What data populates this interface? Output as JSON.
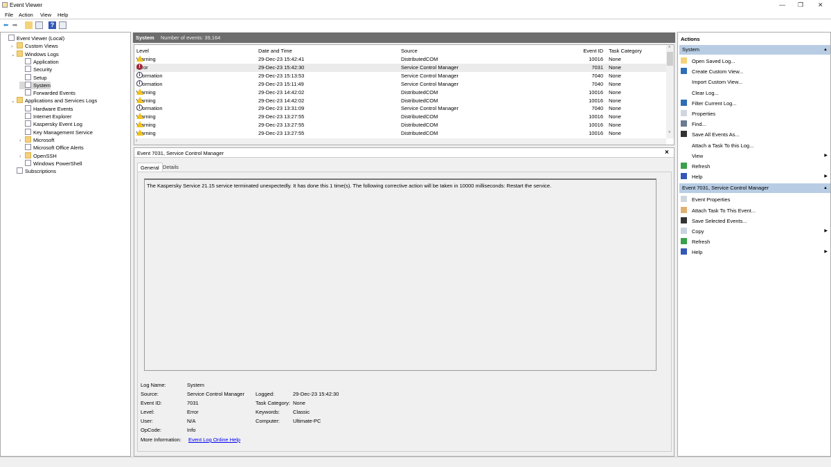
{
  "window": {
    "title": "Event Viewer",
    "minimize": "—",
    "restore": "❐",
    "close": "✕"
  },
  "menu": [
    "File",
    "Action",
    "View",
    "Help"
  ],
  "tree": [
    {
      "label": "Event Viewer (Local)",
      "level": 0,
      "exp": ""
    },
    {
      "label": "Custom Views",
      "level": 1,
      "exp": "›"
    },
    {
      "label": "Windows Logs",
      "level": 1,
      "exp": "⌄"
    },
    {
      "label": "Application",
      "level": 2,
      "exp": ""
    },
    {
      "label": "Security",
      "level": 2,
      "exp": ""
    },
    {
      "label": "Setup",
      "level": 2,
      "exp": ""
    },
    {
      "label": "System",
      "level": 2,
      "exp": "",
      "selected": true
    },
    {
      "label": "Forwarded Events",
      "level": 2,
      "exp": ""
    },
    {
      "label": "Applications and Services Logs",
      "level": 1,
      "exp": "⌄"
    },
    {
      "label": "Hardware Events",
      "level": 2,
      "exp": ""
    },
    {
      "label": "Internet Explorer",
      "level": 2,
      "exp": ""
    },
    {
      "label": "Kaspersky Event Log",
      "level": 2,
      "exp": ""
    },
    {
      "label": "Key Management Service",
      "level": 2,
      "exp": ""
    },
    {
      "label": "Microsoft",
      "level": 2,
      "exp": "›",
      "folder": true
    },
    {
      "label": "Microsoft Office Alerts",
      "level": 2,
      "exp": ""
    },
    {
      "label": "OpenSSH",
      "level": 2,
      "exp": "›",
      "folder": true
    },
    {
      "label": "Windows PowerShell",
      "level": 2,
      "exp": ""
    },
    {
      "label": "Subscriptions",
      "level": 1,
      "exp": ""
    }
  ],
  "log": {
    "name": "System",
    "count_label": "Number of events: 39,164",
    "columns": [
      "Level",
      "Date and Time",
      "Source",
      "Event ID",
      "Task Category"
    ],
    "rows": [
      [
        "Warning",
        "29-Dec-23 15:42:41",
        "DistributedCOM",
        "10016",
        "None"
      ],
      [
        "Error",
        "29-Dec-23 15:42:30",
        "Service Control Manager",
        "7031",
        "None"
      ],
      [
        "Information",
        "29-Dec-23 15:13:53",
        "Service Control Manager",
        "7040",
        "None"
      ],
      [
        "Information",
        "29-Dec-23 15:11:49",
        "Service Control Manager",
        "7040",
        "None"
      ],
      [
        "Warning",
        "29-Dec-23 14:42:02",
        "DistributedCOM",
        "10016",
        "None"
      ],
      [
        "Warning",
        "29-Dec-23 14:42:02",
        "DistributedCOM",
        "10016",
        "None"
      ],
      [
        "Information",
        "29-Dec-23 13:31:09",
        "Service Control Manager",
        "7040",
        "None"
      ],
      [
        "Warning",
        "29-Dec-23 13:27:55",
        "DistributedCOM",
        "10016",
        "None"
      ],
      [
        "Warning",
        "29-Dec-23 13:27:55",
        "DistributedCOM",
        "10016",
        "None"
      ],
      [
        "Warning",
        "29-Dec-23 13:27:55",
        "DistributedCOM",
        "10016",
        "None"
      ]
    ],
    "selected_row": 1
  },
  "detail": {
    "title": "Event 7031, Service Control Manager",
    "close": "×",
    "tabs": [
      "General",
      "Details"
    ],
    "message": "The Kaspersky Service 21.15 service terminated unexpectedly.  It has done this 1 time(s).  The following corrective action will be taken in 10000 milliseconds: Restart the service.",
    "left_fields": [
      [
        "Log Name:",
        "System"
      ],
      [
        "Source:",
        "Service Control Manager"
      ],
      [
        "Event ID:",
        "7031"
      ],
      [
        "Level:",
        "Error"
      ],
      [
        "User:",
        "N/A"
      ],
      [
        "OpCode:",
        "Info"
      ]
    ],
    "right_fields": [
      [
        "Logged:",
        "29-Dec-23 15:42:30"
      ],
      [
        "Task Category:",
        "None"
      ],
      [
        "Keywords:",
        "Classic"
      ],
      [
        "Computer:",
        "Ultimate-PC"
      ]
    ],
    "more_info_label": "More Information:",
    "more_info_link": "Event Log Online Help"
  },
  "actions": {
    "title": "Actions",
    "sections": [
      {
        "title": "System",
        "items": [
          {
            "label": "Open Saved Log...",
            "icon": "folder"
          },
          {
            "label": "Create Custom View...",
            "icon": "filter"
          },
          {
            "label": "Import Custom View...",
            "icon": ""
          },
          {
            "label": "Clear Log...",
            "icon": ""
          },
          {
            "label": "Filter Current Log...",
            "icon": "filter"
          },
          {
            "label": "Properties",
            "icon": "properties"
          },
          {
            "label": "Find...",
            "icon": "find"
          },
          {
            "label": "Save All Events As...",
            "icon": "save"
          },
          {
            "label": "Attach a Task To this Log...",
            "icon": ""
          },
          {
            "label": "View",
            "icon": "",
            "sub": true
          },
          {
            "label": "Refresh",
            "icon": "refresh"
          },
          {
            "label": "Help",
            "icon": "help",
            "sub": true
          }
        ]
      },
      {
        "title": "Event 7031, Service Control Manager",
        "items": [
          {
            "label": "Event Properties",
            "icon": "properties"
          },
          {
            "label": "Attach Task To This Event...",
            "icon": "task"
          },
          {
            "label": "Save Selected Events...",
            "icon": "save"
          },
          {
            "label": "Copy",
            "icon": "copy",
            "sub": true
          },
          {
            "label": "Refresh",
            "icon": "refresh"
          },
          {
            "label": "Help",
            "icon": "help",
            "sub": true
          }
        ]
      }
    ]
  },
  "colors": {
    "header": "#6d6d6d",
    "section": "#b8cde4",
    "warning": "#f2c318",
    "error": "#a0283a"
  }
}
